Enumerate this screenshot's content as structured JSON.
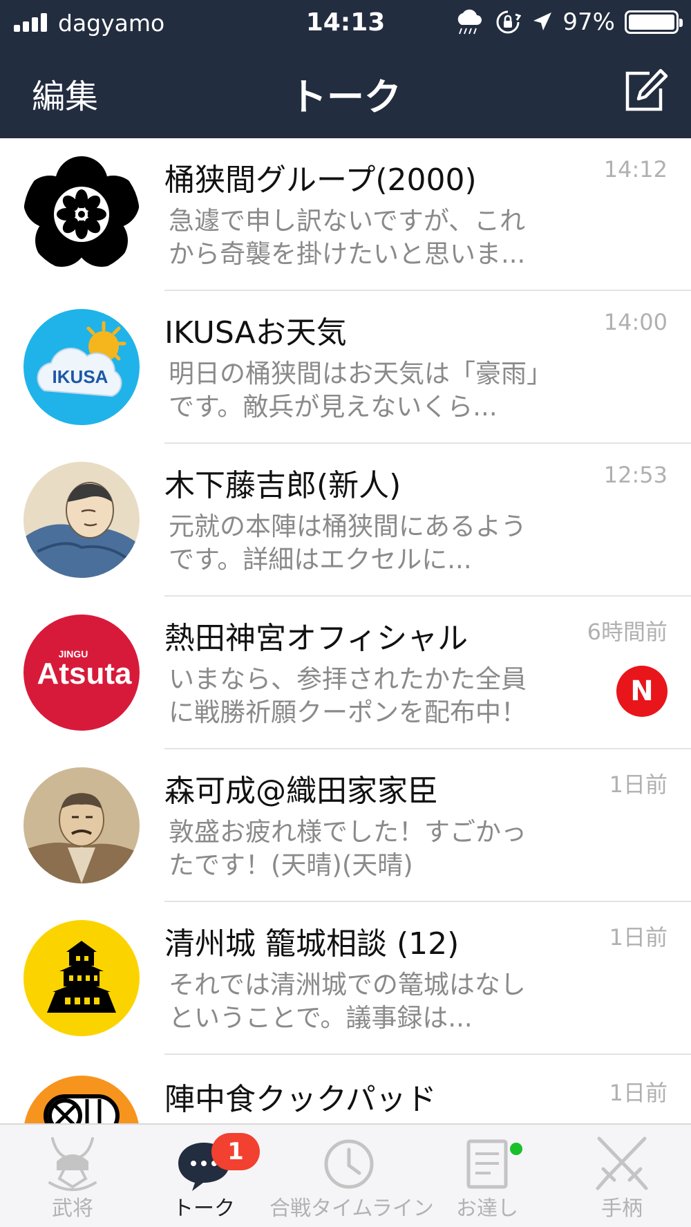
{
  "status_bar": {
    "carrier": "dagyamo",
    "time": "14:13",
    "battery_percent": "97%",
    "signal_bars": 4,
    "icons": [
      "signal-icon",
      "cloud-rain-icon",
      "rotation-lock-icon",
      "location-arrow-icon",
      "battery-icon"
    ]
  },
  "nav": {
    "edit_label": "編集",
    "title": "トーク",
    "compose_icon": "compose-icon"
  },
  "chats": [
    {
      "name": "桶狭間グループ(2000)",
      "preview": "急遽で申し訳ないですが、これから奇襲を掛けたいと思いま...",
      "time": "14:12",
      "avatar": "oda-crest-avatar"
    },
    {
      "name": "IKUSAお天気",
      "preview": "明日の桶狭間はお天気は「豪雨」です。敵兵が見えないくら...",
      "time": "14:00",
      "avatar": "ikusa-weather-avatar",
      "avatar_text": "IKUSA"
    },
    {
      "name": "木下藤吉郎(新人)",
      "preview": "元就の本陣は桶狭間にあるようです。詳細はエクセルに...",
      "time": "12:53",
      "avatar": "samurai-portrait-avatar"
    },
    {
      "name": "熱田神宮オフィシャル",
      "preview": "いまなら、参拝されたかた全員に戦勝祈願クーポンを配布中！",
      "time": "6時間前",
      "badge": "N",
      "avatar": "atsuta-avatar",
      "avatar_text_small": "JINGU",
      "avatar_text": "Atsuta"
    },
    {
      "name": "森可成@織田家家臣",
      "preview": "敦盛お疲れ様でした！すごかったです！(天晴)(天晴)",
      "time": "1日前",
      "avatar": "retainer-portrait-avatar"
    },
    {
      "name": "清州城 籠城相談 (12)",
      "preview": "それでは清洲城での篭城はなしということで。議事録は...",
      "time": "1日前",
      "avatar": "castle-avatar"
    },
    {
      "name": "陣中食クックパッド",
      "preview": "",
      "time": "1日前",
      "avatar": "rice-ball-avatar"
    }
  ],
  "tabs": [
    {
      "label": "武将",
      "icon": "samurai-helmet-icon",
      "active": false
    },
    {
      "label": "トーク",
      "icon": "chat-bubble-icon",
      "active": true,
      "badge": "1"
    },
    {
      "label": "合戦タイムライン",
      "icon": "clock-icon",
      "active": false
    },
    {
      "label": "お達し",
      "icon": "notice-icon",
      "active": false,
      "dot": true
    },
    {
      "label": "手柄",
      "icon": "crossed-swords-icon",
      "active": false
    }
  ],
  "colors": {
    "nav_bg": "#232d40",
    "badge_red": "#e8151b",
    "tab_badge": "#f24130",
    "dot_green": "#19c02a"
  }
}
